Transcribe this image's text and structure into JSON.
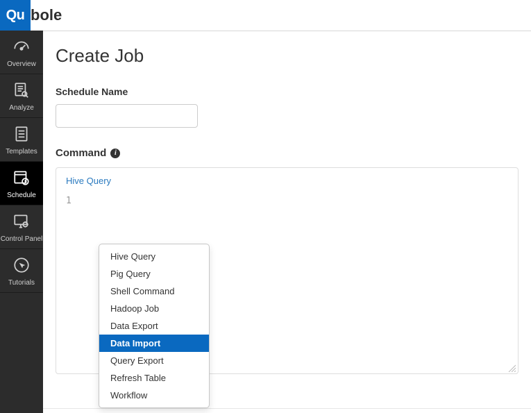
{
  "logo": {
    "tile": "Qu",
    "word": "bole"
  },
  "sidebar": {
    "items": [
      {
        "label": "Overview"
      },
      {
        "label": "Analyze"
      },
      {
        "label": "Templates"
      },
      {
        "label": "Schedule"
      },
      {
        "label": "Control Panel"
      },
      {
        "label": "Tutorials"
      }
    ]
  },
  "page": {
    "title": "Create Job",
    "schedule_name_label": "Schedule Name",
    "schedule_name_value": "",
    "command_label": "Command",
    "command_selected": "Hive Query",
    "query_line_placeholder": "1"
  },
  "command_dropdown": {
    "options": [
      "Hive Query",
      "Pig Query",
      "Shell Command",
      "Hadoop Job",
      "Data Export",
      "Data Import",
      "Query Export",
      "Refresh Table",
      "Workflow"
    ],
    "highlighted_index": 5
  }
}
